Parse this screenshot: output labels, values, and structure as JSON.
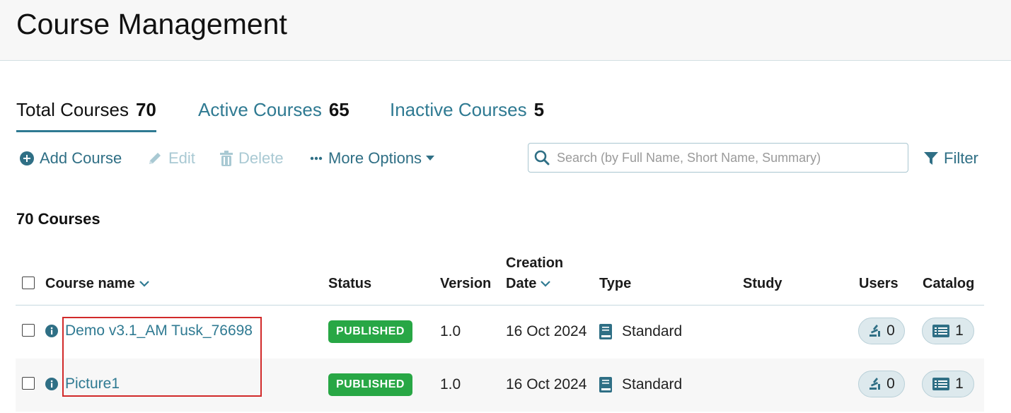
{
  "header": {
    "title": "Course Management"
  },
  "tabs": [
    {
      "label": "Total Courses",
      "count": "70",
      "active": true
    },
    {
      "label": "Active Courses",
      "count": "65",
      "active": false
    },
    {
      "label": "Inactive Courses",
      "count": "5",
      "active": false
    }
  ],
  "toolbar": {
    "add_label": "Add Course",
    "edit_label": "Edit",
    "delete_label": "Delete",
    "more_label": "More Options",
    "search_placeholder": "Search (by Full Name, Short Name, Summary)",
    "filter_label": "Filter"
  },
  "list": {
    "count_title": "70 Courses"
  },
  "table": {
    "headers": {
      "course_name": "Course name",
      "status": "Status",
      "version": "Version",
      "creation_line1": "Creation",
      "creation_line2": "Date",
      "type": "Type",
      "study": "Study",
      "users": "Users",
      "catalog": "Catalog"
    },
    "rows": [
      {
        "name": "Demo v3.1_AM Tusk_76698",
        "status": "PUBLISHED",
        "version": "1.0",
        "date": "16 Oct 2024",
        "type": "Standard",
        "study": "",
        "users": "0",
        "catalog": "1"
      },
      {
        "name": "Picture1",
        "status": "PUBLISHED",
        "version": "1.0",
        "date": "16 Oct 2024",
        "type": "Standard",
        "study": "",
        "users": "0",
        "catalog": "1"
      }
    ]
  },
  "colors": {
    "accent": "#2f7a92",
    "published": "#28a745",
    "highlight": "#d12a2a"
  }
}
